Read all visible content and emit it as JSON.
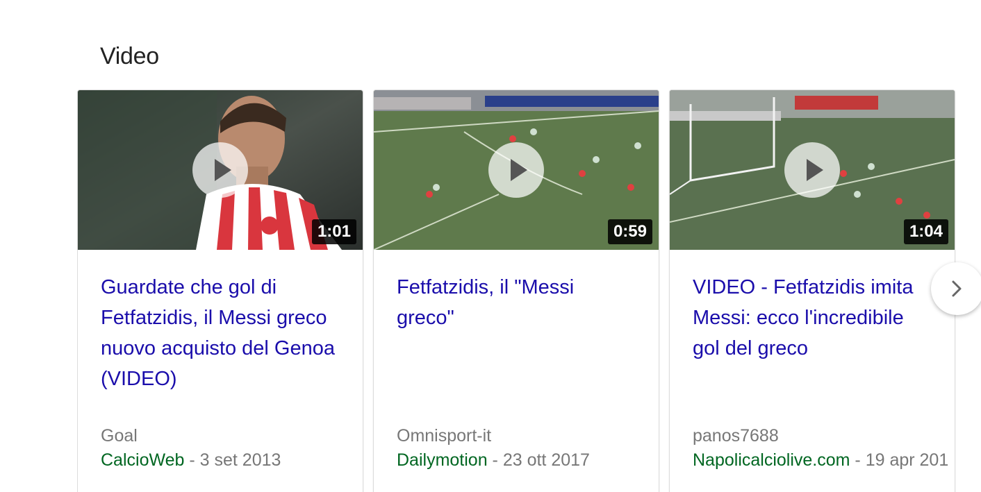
{
  "section": {
    "title": "Video"
  },
  "videos": [
    {
      "duration": "1:01",
      "title": "Guardate che gol di Fetfatzidis, il Messi greco nuovo acquisto del Genoa (VIDEO)",
      "source": "Goal",
      "site": "CalcioWeb",
      "date": " - 3 set 2013"
    },
    {
      "duration": "0:59",
      "title": "Fetfatzidis, il \"Messi greco\"",
      "source": "Omnisport-it",
      "site": "Dailymotion",
      "date": " - 23 ott 2017"
    },
    {
      "duration": "1:04",
      "title": "VIDEO - Fetfatzidis imita Messi: ecco l'incredibile gol del greco",
      "source": "panos7688",
      "site": "Napolicalciolive.com",
      "date": " - 19 apr 201"
    }
  ],
  "icons": {
    "play": "play-icon",
    "next": "chevron-right-icon"
  },
  "colors": {
    "link": "#1a0dab",
    "site": "#006621",
    "muted": "#777777"
  }
}
